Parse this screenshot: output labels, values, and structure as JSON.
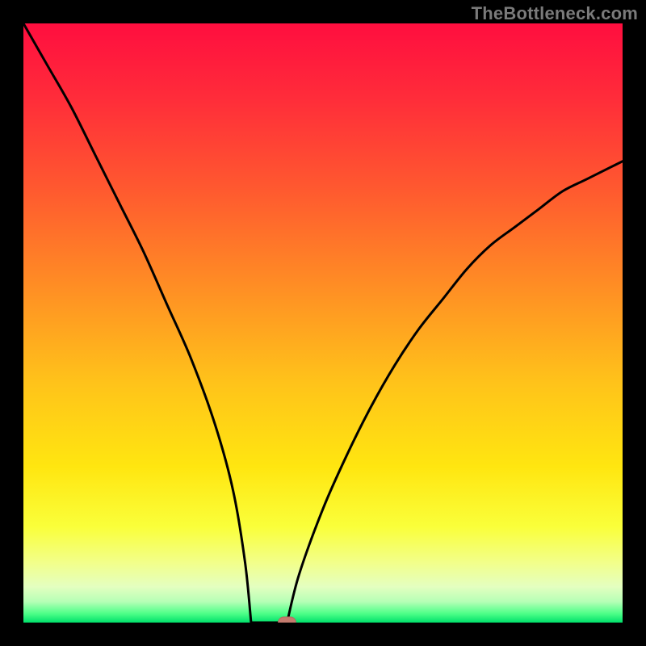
{
  "watermark": "TheBottleneck.com",
  "colors": {
    "background": "#000000",
    "curve": "#000000",
    "marker_fill": "#c47b6e",
    "marker_stroke": "#b36a5e",
    "gradient_stops": [
      {
        "offset": 0.0,
        "color": "#ff0e3f"
      },
      {
        "offset": 0.12,
        "color": "#ff2b3a"
      },
      {
        "offset": 0.28,
        "color": "#ff5a2f"
      },
      {
        "offset": 0.44,
        "color": "#ff8e24"
      },
      {
        "offset": 0.6,
        "color": "#ffc31a"
      },
      {
        "offset": 0.74,
        "color": "#ffe610"
      },
      {
        "offset": 0.84,
        "color": "#faff3a"
      },
      {
        "offset": 0.9,
        "color": "#f2ff8a"
      },
      {
        "offset": 0.94,
        "color": "#e4ffc0"
      },
      {
        "offset": 0.965,
        "color": "#b6ffb6"
      },
      {
        "offset": 0.985,
        "color": "#4dff88"
      },
      {
        "offset": 1.0,
        "color": "#00e06a"
      }
    ]
  },
  "chart_data": {
    "type": "line",
    "title": "",
    "xlabel": "",
    "ylabel": "",
    "xlim": [
      0,
      100
    ],
    "ylim": [
      0,
      100
    ],
    "flat_region": {
      "x_start": 38,
      "x_end": 44,
      "y": 0
    },
    "marker": {
      "x": 44,
      "y": 0
    },
    "series": [
      {
        "name": "curve",
        "x": [
          0,
          4,
          8,
          12,
          16,
          20,
          24,
          28,
          32,
          35,
          37,
          38,
          44,
          46,
          50,
          54,
          58,
          62,
          66,
          70,
          74,
          78,
          82,
          86,
          90,
          94,
          98,
          100
        ],
        "y": [
          100,
          93,
          86,
          78,
          70,
          62,
          53,
          44,
          33,
          22,
          10,
          0,
          0,
          8,
          19,
          28,
          36,
          43,
          49,
          54,
          59,
          63,
          66,
          69,
          72,
          74,
          76,
          77
        ]
      }
    ]
  }
}
